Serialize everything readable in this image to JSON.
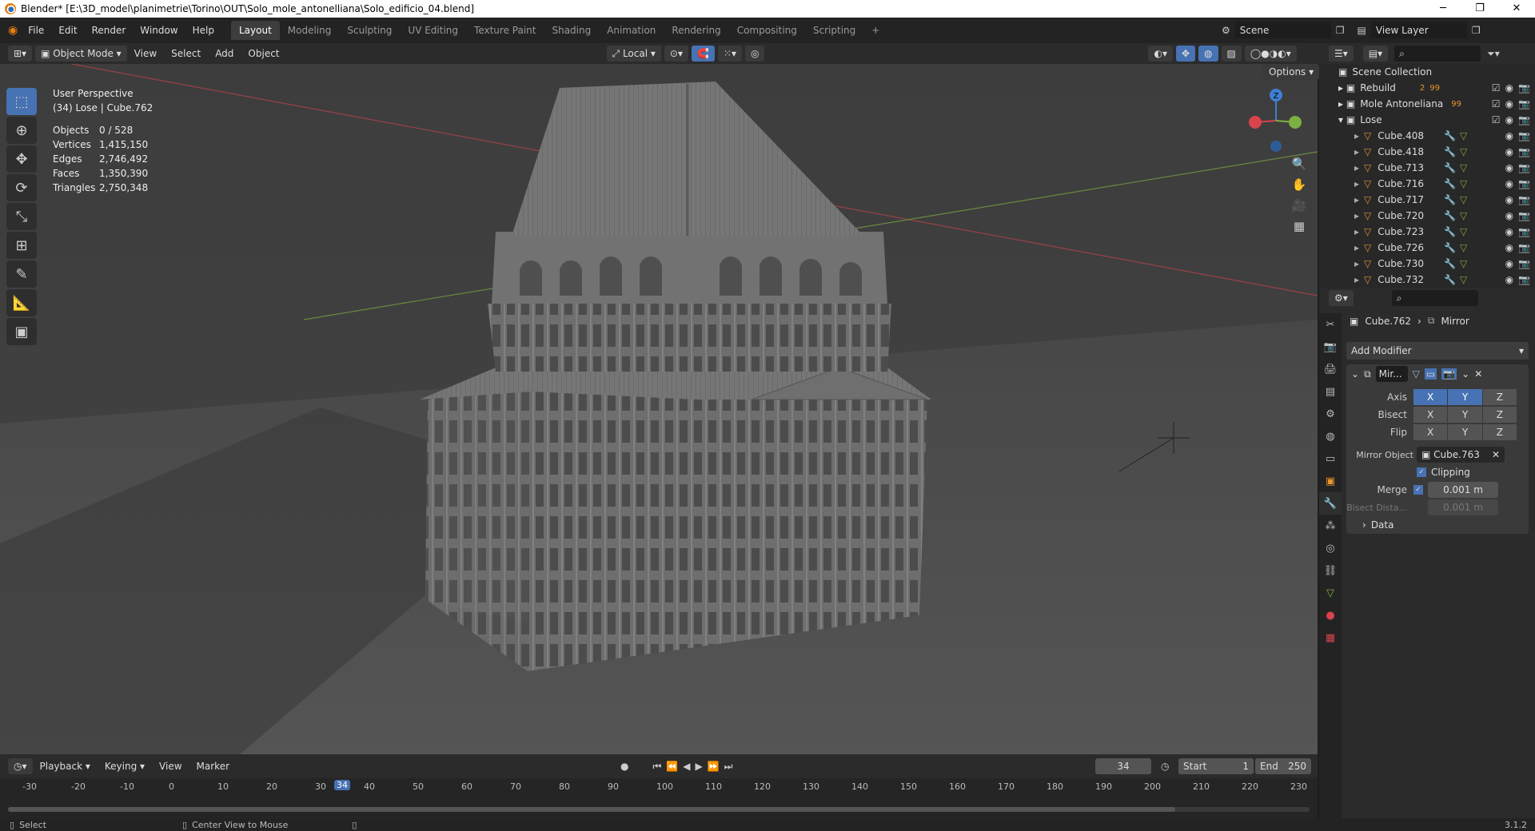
{
  "window": {
    "title": "Blender* [E:\\3D_model\\planimetrie\\Torino\\OUT\\Solo_mole_antonelliana\\Solo_edificio_04.blend]",
    "minimize": "─",
    "maximize": "❐",
    "close": "✕"
  },
  "menu": [
    "File",
    "Edit",
    "Render",
    "Window",
    "Help"
  ],
  "workspaces": [
    "Layout",
    "Modeling",
    "Sculpting",
    "UV Editing",
    "Texture Paint",
    "Shading",
    "Animation",
    "Rendering",
    "Compositing",
    "Scripting"
  ],
  "active_workspace": "Layout",
  "scene_name": "Scene",
  "view_layer": "View Layer",
  "viewport_header": {
    "mode": "Object Mode",
    "menus": [
      "View",
      "Select",
      "Add",
      "Object"
    ],
    "orientation": "Local",
    "options": "Options"
  },
  "viewport_info": {
    "perspective": "User Perspective",
    "context": "(34) Lose | Cube.762",
    "stats": [
      {
        "label": "Objects",
        "value": "0 / 528"
      },
      {
        "label": "Vertices",
        "value": "1,415,150"
      },
      {
        "label": "Edges",
        "value": "2,746,492"
      },
      {
        "label": "Faces",
        "value": "1,350,390"
      },
      {
        "label": "Triangles",
        "value": "2,750,348"
      }
    ]
  },
  "gizmo": {
    "x": "X",
    "y": "Y",
    "z": "Z"
  },
  "outliner": {
    "root": "Scene Collection",
    "collections": [
      {
        "name": "Rebuild",
        "badge": "2",
        "badge2": "99"
      },
      {
        "name": "Mole Antoneliana",
        "badge": "99"
      },
      {
        "name": "Lose"
      }
    ],
    "objects": [
      "Cube.408",
      "Cube.418",
      "Cube.713",
      "Cube.716",
      "Cube.717",
      "Cube.720",
      "Cube.723",
      "Cube.726",
      "Cube.730",
      "Cube.732"
    ]
  },
  "properties": {
    "object": "Cube.762",
    "modifier": "Mirror",
    "add_modifier": "Add Modifier",
    "mod_name": "Mir...",
    "axis_label": "Axis",
    "bisect_label": "Bisect",
    "flip_label": "Flip",
    "axes": [
      "X",
      "Y",
      "Z"
    ],
    "mirror_object_label": "Mirror Object",
    "mirror_object": "Cube.763",
    "clipping": "Clipping",
    "merge_label": "Merge",
    "merge_value": "0.001 m",
    "bisect_distance_label": "Bisect Dista...",
    "bisect_distance_value": "0.001 m",
    "data": "Data"
  },
  "timeline": {
    "menus": [
      "Playback",
      "Keying",
      "View",
      "Marker"
    ],
    "current_frame": "34",
    "start_label": "Start",
    "start": "1",
    "end_label": "End",
    "end": "250",
    "ticks": [
      "-30",
      "-20",
      "-10",
      "0",
      "10",
      "20",
      "30",
      "40",
      "50",
      "60",
      "70",
      "80",
      "90",
      "100",
      "110",
      "120",
      "130",
      "140",
      "150",
      "160",
      "170",
      "180",
      "190",
      "200",
      "210",
      "220",
      "230"
    ]
  },
  "status": {
    "left": "Select",
    "middle": "Center View to Mouse",
    "version": "3.1.2"
  },
  "colors": {
    "accent": "#4772b3",
    "x_axis": "#d9434b",
    "y_axis": "#7db042",
    "z_axis": "#3f7fd1",
    "object_icon": "#e8952e"
  }
}
